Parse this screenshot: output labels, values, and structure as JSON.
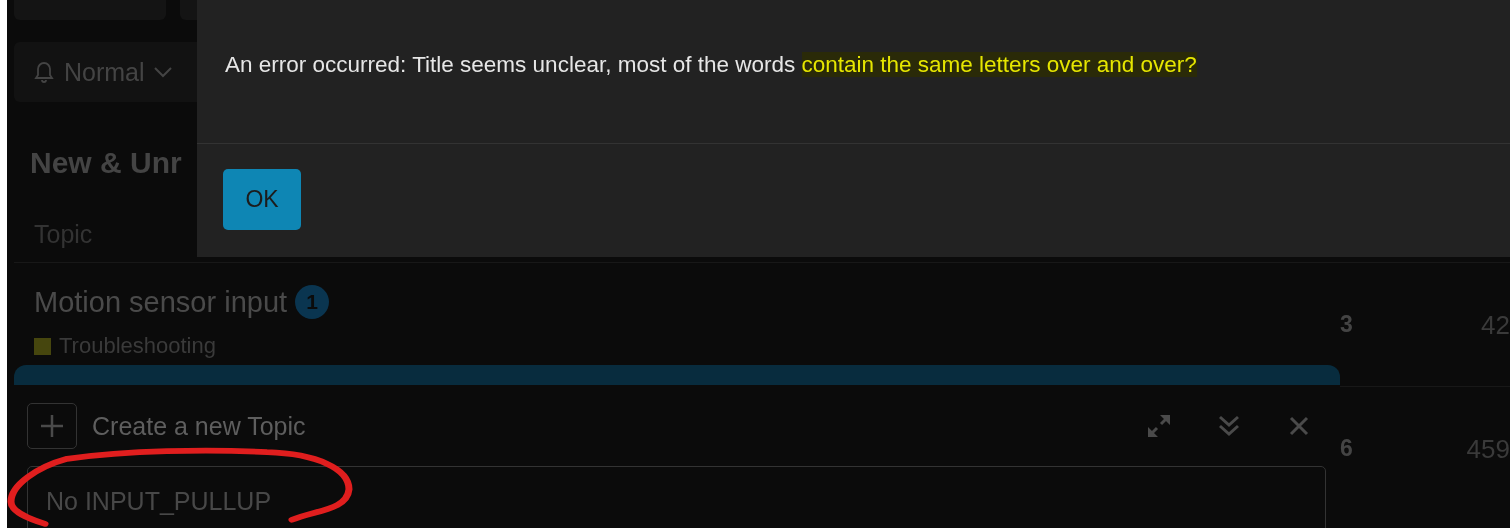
{
  "notification_dropdown": {
    "label": "Normal"
  },
  "list_title": "New & Unr",
  "table": {
    "columns": [
      "Topic"
    ],
    "rows": [
      {
        "title": "Motion sensor input",
        "unread_count": "1",
        "category": {
          "name": "Troubleshooting",
          "color": "#46460e"
        },
        "column_2": "3",
        "column_3": "42"
      },
      {
        "column_2": "6",
        "column_3": "459"
      }
    ]
  },
  "composer": {
    "title": "Create a new Topic",
    "title_field": {
      "value": "No INPUT_PULLUP"
    }
  },
  "dialog": {
    "message": "An error occurred: Title seems unclear, most of the words ",
    "highlighted": "contain the same letters over and over?",
    "buttons": [
      "OK"
    ]
  },
  "annotations": [
    {
      "kind": "circle"
    }
  ]
}
